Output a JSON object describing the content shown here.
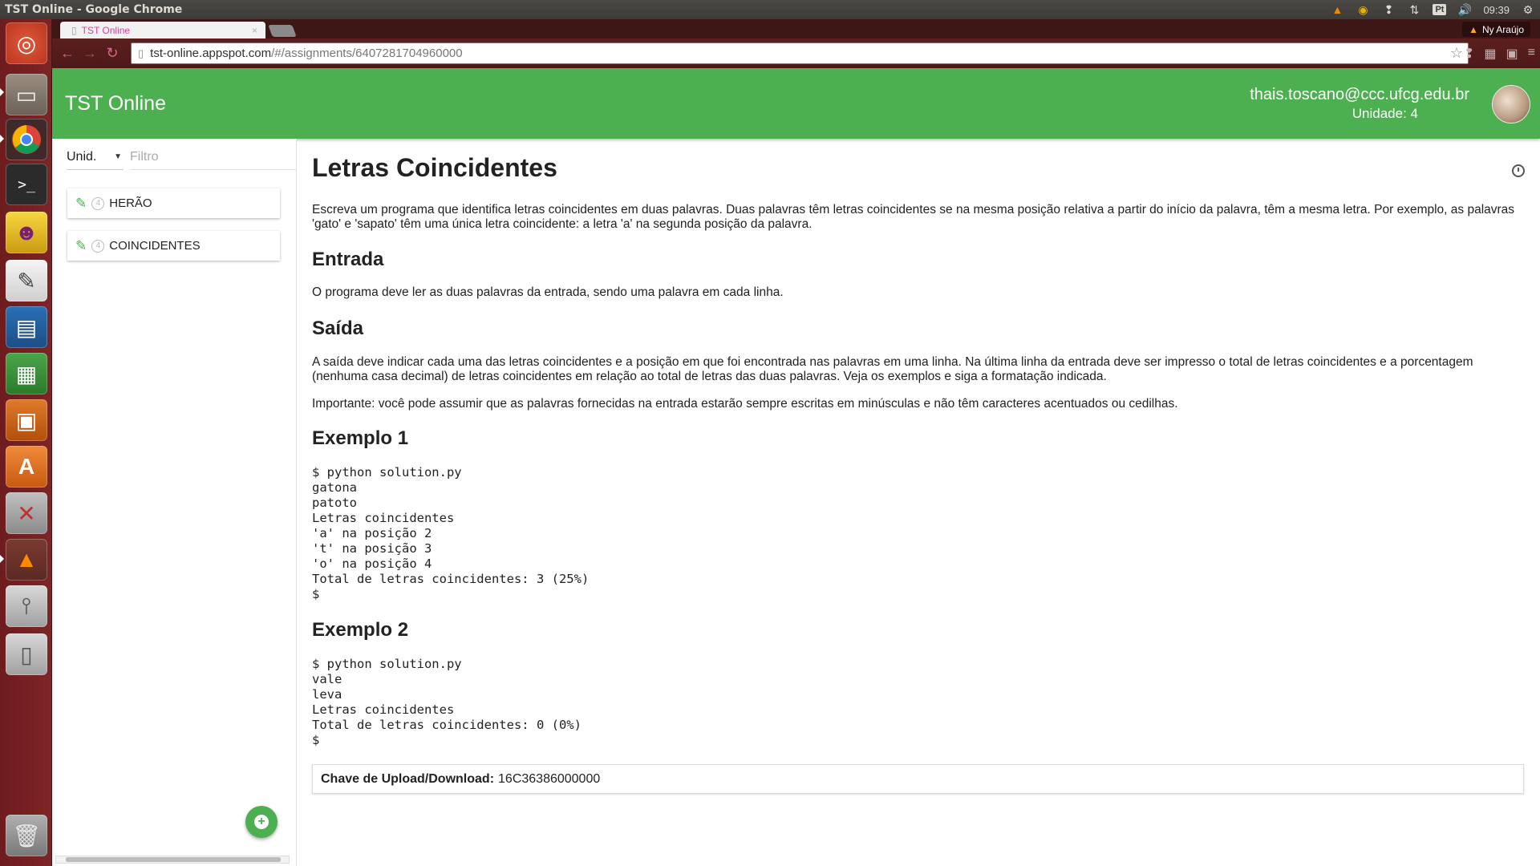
{
  "os": {
    "window_title": "TST Online - Google Chrome",
    "tray": {
      "language": "Pt",
      "time": "09:39"
    }
  },
  "browser": {
    "tab_title": "TST Online",
    "tab_close": "×",
    "url_host": "tst-online.appspot.com",
    "url_path": "/#/assignments/6407281704960000",
    "profile_name": "Ny Araújo"
  },
  "app": {
    "title": "TST Online",
    "user_email": "thais.toscano@ccc.ufcg.edu.br",
    "user_unit": "Unidade: 4",
    "accent": "#4caf50"
  },
  "sidebar": {
    "unit_select": "Unid.",
    "filter_placeholder": "Filtro",
    "items": [
      {
        "label": "HERÃO",
        "badge": "4"
      },
      {
        "label": "COINCIDENTES",
        "badge": "4"
      }
    ]
  },
  "problem": {
    "title": "Letras Coincidentes",
    "intro": "Escreva um programa que identifica letras coincidentes em duas palavras. Duas palavras têm letras coincidentes se na mesma posição relativa a partir do início da palavra, têm a mesma letra. Por exemplo, as palavras 'gato' e 'sapato' têm uma única letra coincidente: a letra 'a' na segunda posição da palavra.",
    "input_heading": "Entrada",
    "input_text": "O programa deve ler as duas palavras da entrada, sendo uma palavra em cada linha.",
    "output_heading": "Saída",
    "output_text": "A saída deve indicar cada uma das letras coincidentes e a posição em que foi encontrada nas palavras em uma linha. Na última linha da entrada deve ser impresso o total de letras coincidentes e a porcentagem (nenhuma casa decimal) de letras coincidentes em relação ao total de letras das duas palavras. Veja os exemplos e siga a formatação indicada.",
    "note_text": "Importante: você pode assumir que as palavras fornecidas na entrada estarão sempre escritas em minúsculas e não têm caracteres acentuados ou cedilhas.",
    "example1_heading": "Exemplo 1",
    "example1_code": "$ python solution.py\ngatona\npatoto\nLetras coincidentes\n'a' na posição 2\n't' na posição 3\n'o' na posição 4\nTotal de letras coincidentes: 3 (25%)\n$",
    "example2_heading": "Exemplo 2",
    "example2_code": "$ python solution.py\nvale\nleva\nLetras coincidentes\nTotal de letras coincidentes: 0 (0%)\n$",
    "key_label": "Chave de Upload/Download:",
    "key_value": "16C36386000000"
  }
}
